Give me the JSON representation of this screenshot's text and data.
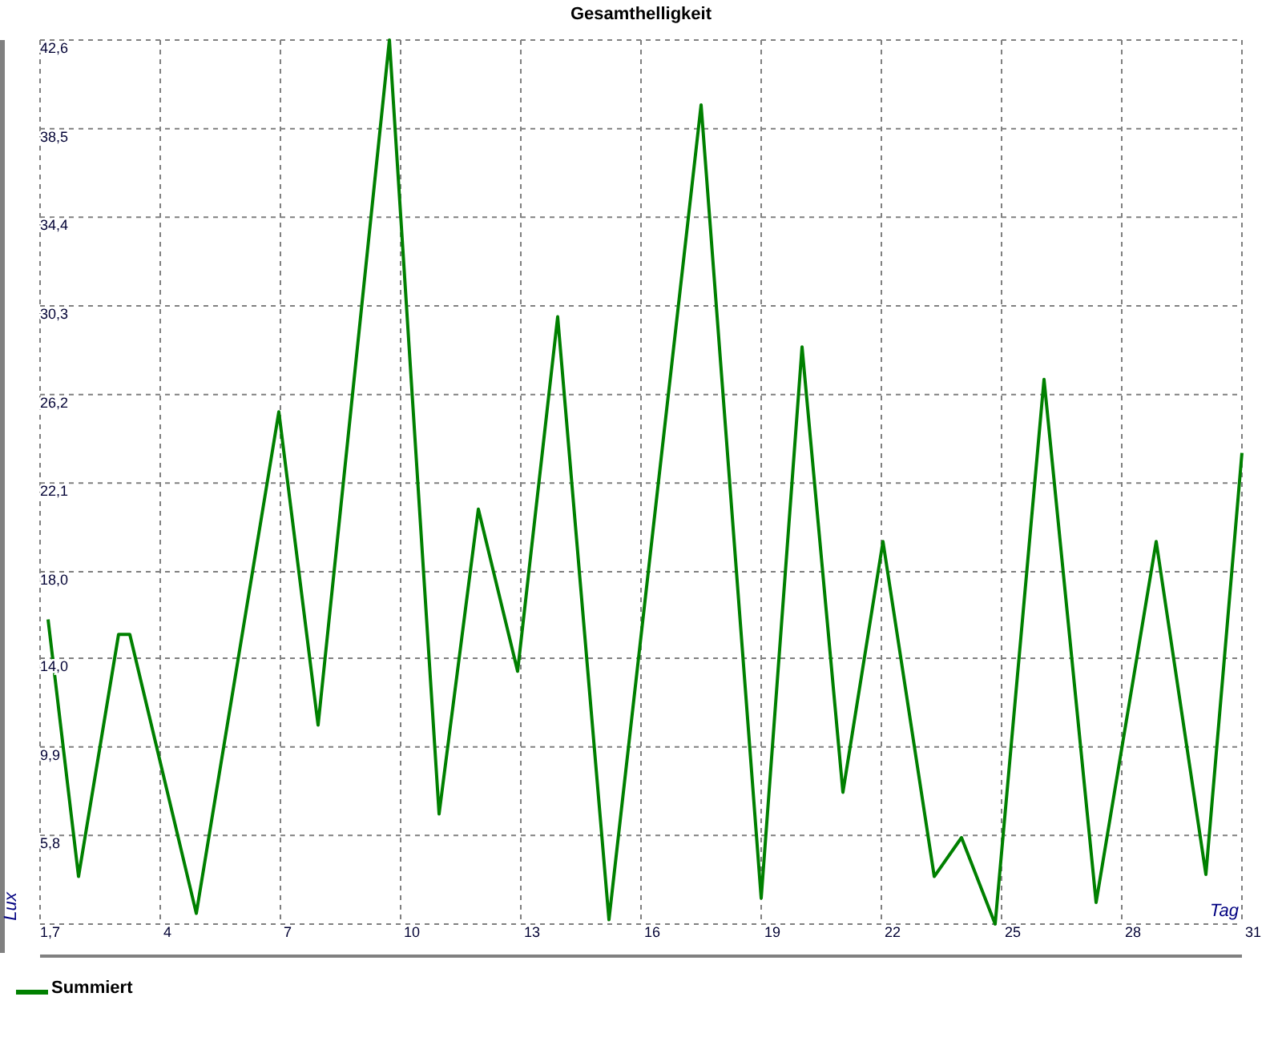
{
  "chart": {
    "chart_data": {
      "type": "line",
      "title": "Gesamthelligkeit",
      "xlabel": "Tag",
      "ylabel": "Lux",
      "xlim": [
        1,
        31
      ],
      "ylim": [
        1.7,
        42.6
      ],
      "xticks": [
        4,
        7,
        10,
        13,
        16,
        19,
        22,
        25,
        28,
        31
      ],
      "yticks": [
        {
          "value": 1.7,
          "label": "1,7"
        },
        {
          "value": 5.8,
          "label": "5,8"
        },
        {
          "value": 9.9,
          "label": "9,9"
        },
        {
          "value": 14.0,
          "label": "14,0"
        },
        {
          "value": 18.0,
          "label": "18,0"
        },
        {
          "value": 22.1,
          "label": "22,1"
        },
        {
          "value": 26.2,
          "label": "26,2"
        },
        {
          "value": 30.3,
          "label": "30,3"
        },
        {
          "value": 34.4,
          "label": "34,4"
        },
        {
          "value": 38.5,
          "label": "38,5"
        },
        {
          "value": 42.6,
          "label": "42,6"
        }
      ],
      "grid": true,
      "x": [
        1.0,
        1.76,
        2.76,
        3.04,
        4.7,
        6.76,
        7.74,
        9.52,
        10.76,
        11.74,
        12.72,
        13.72,
        15.0,
        17.3,
        18.8,
        19.82,
        20.84,
        21.84,
        23.12,
        23.8,
        24.64,
        25.86,
        27.16,
        28.66,
        29.9,
        30.8
      ],
      "series": [
        {
          "name": "Summiert",
          "color": "#008000",
          "values": [
            15.8,
            3.9,
            15.1,
            15.1,
            2.2,
            25.4,
            10.9,
            42.6,
            6.8,
            20.9,
            13.4,
            29.8,
            1.9,
            39.6,
            2.9,
            28.4,
            7.8,
            19.4,
            3.9,
            5.7,
            1.7,
            26.9,
            2.7,
            19.4,
            4.0,
            23.5
          ]
        }
      ]
    }
  }
}
